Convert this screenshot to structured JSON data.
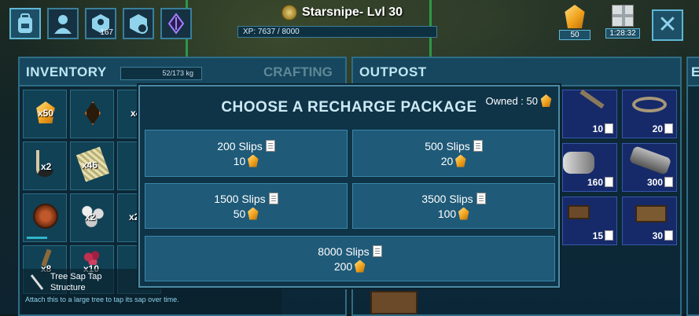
{
  "header": {
    "player_name": "Starsnipe- Lvl 30",
    "xp_text": "XP: 7637 / 8000",
    "tribe_count": "167",
    "gems_count": "50",
    "timer": "1:28:32"
  },
  "inventory": {
    "title": "INVENTORY",
    "weight": "52/173 kg",
    "crafting_tab": "CRAFTING",
    "cells": [
      {
        "qty": "x50",
        "icon": "amber-icon"
      },
      {
        "qty": "",
        "icon": "element-icon"
      },
      {
        "qty": "x4",
        "icon": "item-icon"
      },
      {
        "qty": "x2",
        "icon": "narcotic-icon"
      },
      {
        "qty": "x46",
        "icon": "fiber-icon"
      },
      {
        "qty": "",
        "icon": "item-icon"
      },
      {
        "qty": "",
        "icon": "egg-icon"
      },
      {
        "qty": "x2",
        "icon": "mushroom-icon"
      },
      {
        "qty": "x2",
        "icon": "item-icon"
      },
      {
        "qty": "x8",
        "icon": "item-icon"
      },
      {
        "qty": "x10",
        "icon": "berries-icon"
      },
      {
        "qty": "",
        "icon": "item-icon"
      }
    ]
  },
  "outpost": {
    "title": "OUTPOST",
    "items": [
      {
        "count": "10",
        "icon": "crossbow-icon"
      },
      {
        "count": "20",
        "icon": "rope-icon"
      },
      {
        "count": "160",
        "icon": "scope-icon"
      },
      {
        "count": "300",
        "icon": "launcher-icon"
      },
      {
        "count": "15",
        "icon": "crate-icon"
      },
      {
        "count": "30",
        "icon": "crate-icon"
      }
    ]
  },
  "edge_panel_title": "E",
  "tooltip": {
    "name": "Tree Sap Tap",
    "type": "Structure",
    "description": "Attach this to a large tree to tap its sap over time."
  },
  "modal": {
    "title": "CHOOSE A RECHARGE PACKAGE",
    "owned": "Owned : 50",
    "packages": [
      {
        "slips": "200 Slips",
        "cost": "10"
      },
      {
        "slips": "500 Slips",
        "cost": "20"
      },
      {
        "slips": "1500 Slips",
        "cost": "50"
      },
      {
        "slips": "3500 Slips",
        "cost": "100"
      },
      {
        "slips": "8000 Slips",
        "cost": "200"
      }
    ]
  },
  "colors": {
    "accent": "#5fb7d4",
    "panel": "#0f3448",
    "button": "#1f5a78",
    "amber": "#f0a21d"
  }
}
